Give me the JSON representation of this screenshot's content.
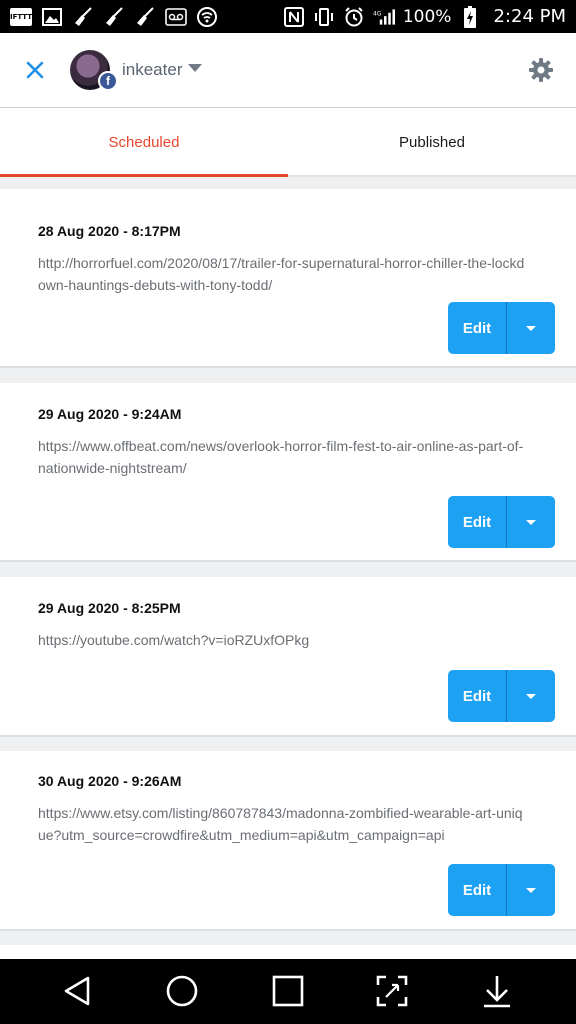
{
  "status_bar": {
    "left_icons": [
      "ifttt-icon",
      "image-icon",
      "broom-icon",
      "broom-icon",
      "broom-icon",
      "voicemail-icon",
      "wifi-tether-icon"
    ],
    "ifttt_label": "IFTTT",
    "right_icons": [
      "nfc-icon",
      "vibrate-icon",
      "alarm-icon",
      "lte-signal-icon",
      "battery-charging-icon"
    ],
    "battery": "100%",
    "time": "2:24 PM"
  },
  "header": {
    "close_icon": "close-icon",
    "account_name": "inkeater",
    "badge_letter": "f",
    "settings_icon": "gear-icon"
  },
  "tabs": [
    {
      "label": "Scheduled",
      "active": true
    },
    {
      "label": "Published",
      "active": false
    }
  ],
  "posts": [
    {
      "date": "28 Aug 2020 - 8:17PM",
      "url": "http://horrorfuel.com/2020/08/17/trailer-for-supernatural-horror-chiller-the-lockdown-hauntings-debuts-with-tony-todd/",
      "edit_label": "Edit"
    },
    {
      "date": "29 Aug 2020 - 9:24AM",
      "url": "https://www.offbeat.com/news/overlook-horror-film-fest-to-air-online-as-part-of-nationwide-nightstream/",
      "edit_label": "Edit"
    },
    {
      "date": "29 Aug 2020 - 8:25PM",
      "url": "https://youtube.com/watch?v=ioRZUxfOPkg",
      "edit_label": "Edit"
    },
    {
      "date": "30 Aug 2020 - 9:26AM",
      "url": "https://www.etsy.com/listing/860787843/madonna-zombified-wearable-art-unique?utm_source=crowdfire&utm_medium=api&utm_campaign=api",
      "edit_label": "Edit"
    }
  ],
  "nav_bar": [
    "back-icon",
    "home-icon",
    "recents-icon",
    "screen-capture-icon",
    "notification-pull-icon"
  ],
  "colors": {
    "accent": "#e8452c",
    "edit_button": "#1da1f2",
    "facebook": "#3b5998"
  }
}
